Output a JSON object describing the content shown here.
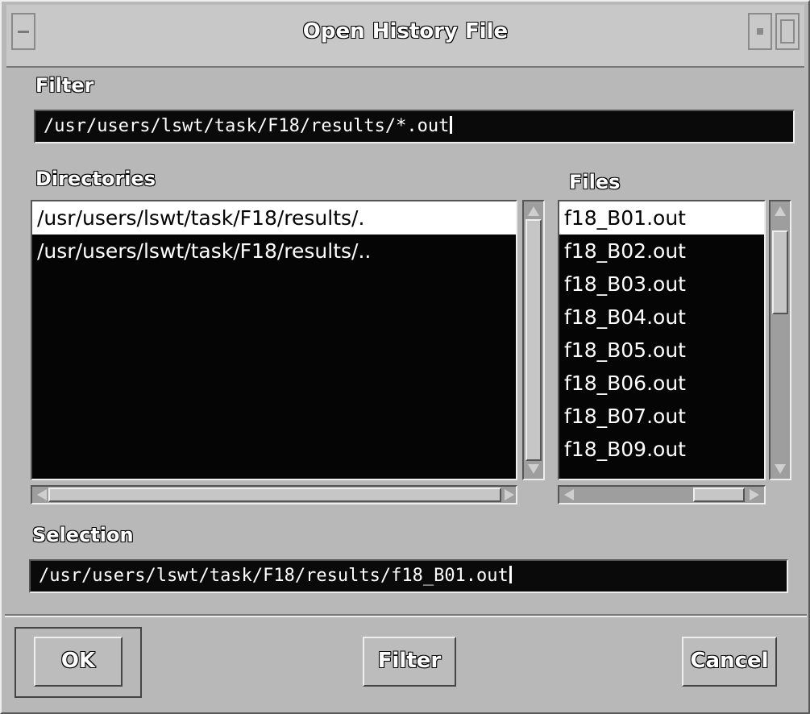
{
  "window": {
    "title": "Open History File"
  },
  "filter": {
    "label": "Filter",
    "value": "/usr/users/lswt/task/F18/results/*.out"
  },
  "directories": {
    "label": "Directories",
    "items": [
      "/usr/users/lswt/task/F18/results/.",
      "/usr/users/lswt/task/F18/results/.."
    ],
    "selected_index": 0
  },
  "files": {
    "label": "Files",
    "items": [
      "f18_B01.out",
      "f18_B02.out",
      "f18_B03.out",
      "f18_B04.out",
      "f18_B05.out",
      "f18_B06.out",
      "f18_B07.out",
      "f18_B09.out"
    ],
    "selected_index": 0
  },
  "selection": {
    "label": "Selection",
    "value": "/usr/users/lswt/task/F18/results/f18_B01.out"
  },
  "buttons": {
    "ok": "OK",
    "filter": "Filter",
    "cancel": "Cancel"
  },
  "icons": {
    "window_menu": "window-menu-icon",
    "minimize": "minimize-icon",
    "maximize": "maximize-icon"
  }
}
